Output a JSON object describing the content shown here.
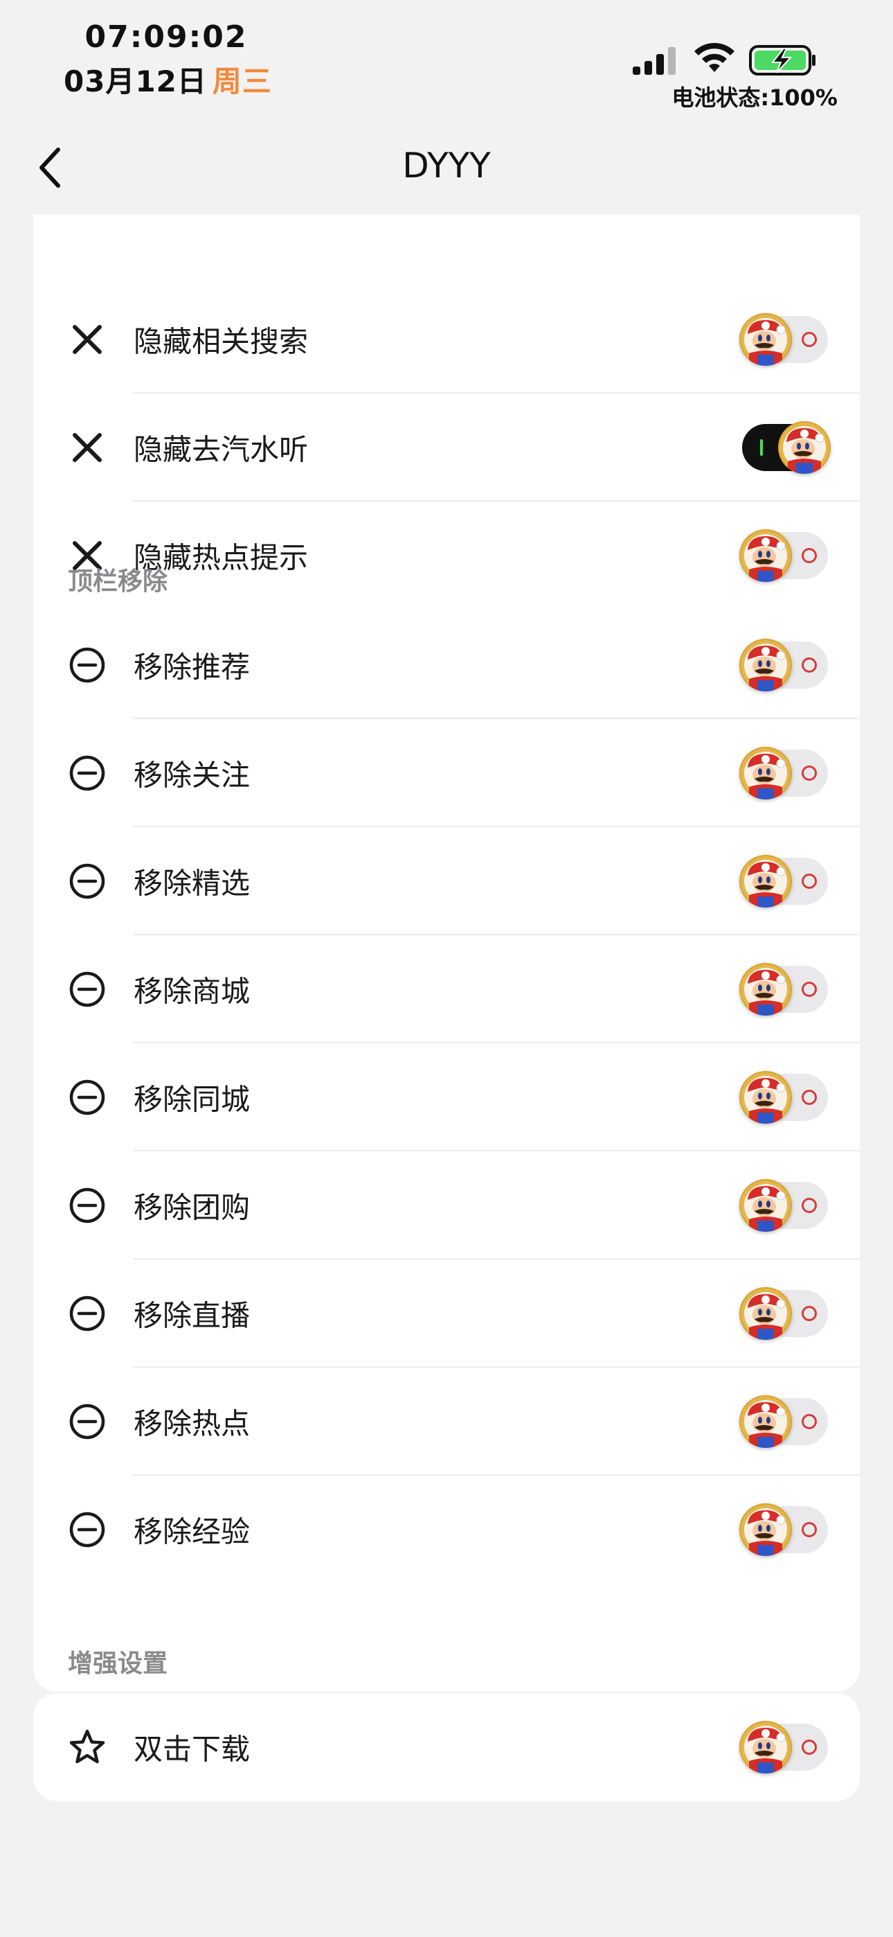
{
  "status_bar": {
    "time": "07:09:02",
    "date": "03月12日",
    "weekday": "周三",
    "battery_status": "电池状态:100%"
  },
  "nav": {
    "title": "DYYY"
  },
  "hide_section": {
    "items": [
      {
        "label": "隐藏相关搜索",
        "icon": "x-icon",
        "enabled": false
      },
      {
        "label": "隐藏去汽水听",
        "icon": "x-icon",
        "enabled": true
      },
      {
        "label": "隐藏热点提示",
        "icon": "x-icon",
        "enabled": false
      }
    ]
  },
  "topbar_section": {
    "header": "顶栏移除",
    "items": [
      {
        "label": "移除推荐",
        "icon": "minus-circle-icon",
        "enabled": false
      },
      {
        "label": "移除关注",
        "icon": "minus-circle-icon",
        "enabled": false
      },
      {
        "label": "移除精选",
        "icon": "minus-circle-icon",
        "enabled": false
      },
      {
        "label": "移除商城",
        "icon": "minus-circle-icon",
        "enabled": false
      },
      {
        "label": "移除同城",
        "icon": "minus-circle-icon",
        "enabled": false
      },
      {
        "label": "移除团购",
        "icon": "minus-circle-icon",
        "enabled": false
      },
      {
        "label": "移除直播",
        "icon": "minus-circle-icon",
        "enabled": false
      },
      {
        "label": "移除热点",
        "icon": "minus-circle-icon",
        "enabled": false
      },
      {
        "label": "移除经验",
        "icon": "minus-circle-icon",
        "enabled": false
      }
    ]
  },
  "enhance_section": {
    "header": "增强设置",
    "items": [
      {
        "label": "双击下载",
        "icon": "star-icon",
        "enabled": false
      }
    ]
  },
  "colors": {
    "background": "#f2f2f2",
    "card": "#ffffff",
    "weekday_accent": "#f28a3c",
    "toggle_on": "#111111",
    "toggle_off": "#e9e9eb",
    "section_header": "#8a8a8e"
  }
}
